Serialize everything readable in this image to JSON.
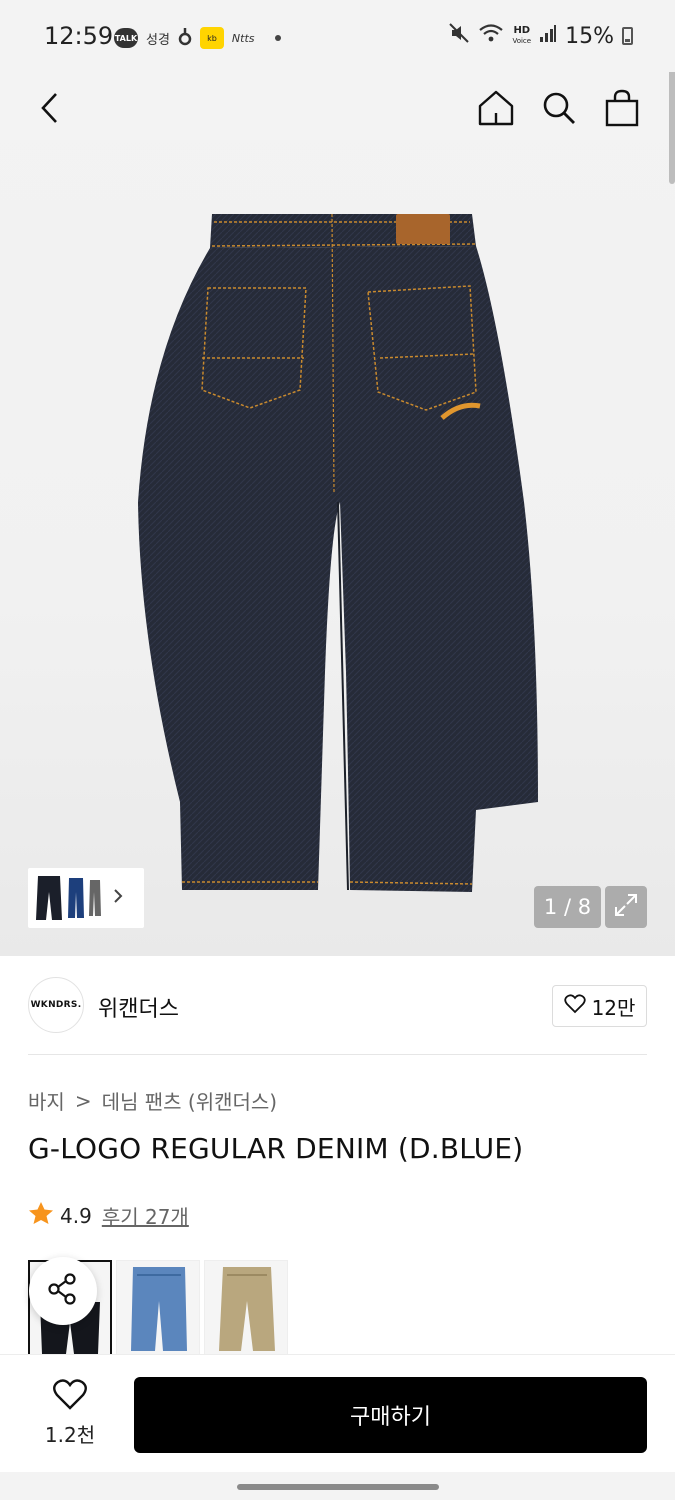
{
  "status_bar": {
    "time": "12:59",
    "talk_badge": "TALK",
    "sleep_label": "성경",
    "yellow_badge": "kb",
    "note_label": "Ntts",
    "hd_label": "HD",
    "volte_label": "Voice",
    "battery": "15%"
  },
  "header": {
    "back_icon": "chevron-left-icon",
    "home_icon": "home-icon",
    "search_icon": "search-icon",
    "bag_icon": "shopping-bag-icon"
  },
  "gallery": {
    "counter": "1 / 8",
    "expand_icon": "expand-icon"
  },
  "brand": {
    "logo_text": "WKNDRS.",
    "name": "위캔더스",
    "like_count": "12만"
  },
  "breadcrumb": {
    "category": "바지",
    "separator": ">",
    "subcategory": "데님 팬츠 (위캔더스)"
  },
  "product": {
    "title": "G-LOGO REGULAR DENIM (D.BLUE)",
    "rating": "4.9",
    "reviews": "후기 27개"
  },
  "bottom_bar": {
    "wish_count": "1.2천",
    "buy_label": "구매하기"
  },
  "colors": {
    "denim": "#262b38",
    "stitch": "#c98a2e",
    "star": "#f7941d",
    "buy_bg": "#000000"
  }
}
